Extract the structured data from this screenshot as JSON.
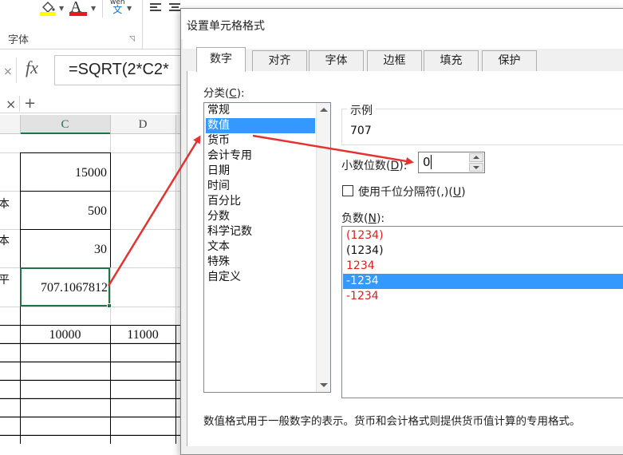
{
  "ribbon": {
    "group_label": "字体",
    "wen_pinyin": "wén",
    "wen_char": "文",
    "font_color_letter": "A",
    "fill_color": "#ffff00",
    "font_color": "#e41c1c"
  },
  "formula_bar": {
    "fx_label": "fx",
    "formula": "=SQRT(2*C2*",
    "cancel_label": "×"
  },
  "sheet_tabs": {
    "close_label": "×",
    "add_label": "+"
  },
  "columns": {
    "c": "C",
    "d": "D"
  },
  "cells": {
    "c_row1": "15000",
    "c_row2": "500",
    "c_row3": "30",
    "c_row4": "707.1067812",
    "c_row6": "10000",
    "d_row6": "11000",
    "frag_row2": "本",
    "frag_row3": "本",
    "frag_row4": "平"
  },
  "dialog": {
    "title": "设置单元格格式",
    "tabs": [
      "数字",
      "对齐",
      "字体",
      "边框",
      "填充",
      "保护"
    ],
    "active_tab": "数字",
    "category_label": "分类(",
    "category_hotkey": "C",
    "category_label_end": "):",
    "categories": [
      "常规",
      "数值",
      "货币",
      "会计专用",
      "日期",
      "时间",
      "百分比",
      "分数",
      "科学记数",
      "文本",
      "特殊",
      "自定义"
    ],
    "selected_category": "数值",
    "sample_label": "示例",
    "sample_value": "707",
    "decimals_label": "小数位数(",
    "decimals_hotkey": "D",
    "decimals_label_end": "):",
    "decimals_value": "0",
    "thousands_label": "使用千位分隔符(,)(",
    "thousands_hotkey": "U",
    "thousands_label_end": ")",
    "thousands_checked": false,
    "negative_label": "负数(",
    "negative_hotkey": "N",
    "negative_label_end": "):",
    "negative_options": [
      {
        "text": "(1234)",
        "color": "#e41c1c"
      },
      {
        "text": "(1234)",
        "color": "#111111"
      },
      {
        "text": "1234",
        "color": "#e41c1c"
      },
      {
        "text": "-1234",
        "color": "#ffffff"
      },
      {
        "text": "-1234",
        "color": "#e41c1c"
      }
    ],
    "selected_negative_index": 3,
    "footer": "数值格式用于一般数字的表示。货币和会计格式则提供货币值计算的专用格式。"
  },
  "colors": {
    "selection": "#3399ff",
    "excel_green": "#217346",
    "annotation_red": "#e8312f"
  }
}
